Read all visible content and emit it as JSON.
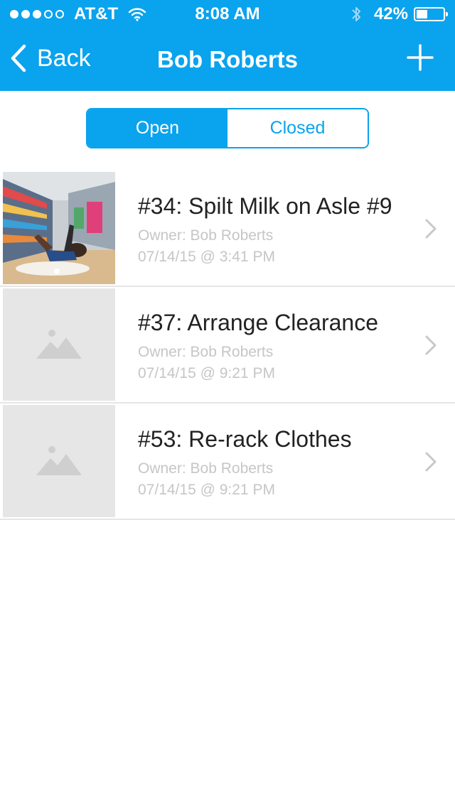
{
  "status": {
    "carrier": "AT&T",
    "time": "8:08 AM",
    "battery": "42%",
    "battery_level": 0.42
  },
  "nav": {
    "back_label": "Back",
    "title": "Bob Roberts"
  },
  "segment": {
    "open_label": "Open",
    "closed_label": "Closed",
    "selected": "Open"
  },
  "tasks": [
    {
      "title": "#34: Spilt Milk on Asle #9",
      "owner": "Owner: Bob Roberts",
      "date": "07/14/15 @ 3:41 PM",
      "has_photo": true
    },
    {
      "title": "#37: Arrange Clearance",
      "owner": "Owner: Bob Roberts",
      "date": "07/14/15 @ 9:21 PM",
      "has_photo": false
    },
    {
      "title": "#53: Re-rack Clothes",
      "owner": "Owner: Bob Roberts",
      "date": "07/14/15 @ 9:21 PM",
      "has_photo": false
    }
  ],
  "colors": {
    "accent": "#0aa3ee",
    "muted_text": "#c6c6c6",
    "placeholder_bg": "#e6e6e6"
  },
  "icons": {
    "back": "chevron-left-icon",
    "add": "plus-icon",
    "row_disclosure": "chevron-right-icon",
    "placeholder": "image-placeholder-icon"
  }
}
